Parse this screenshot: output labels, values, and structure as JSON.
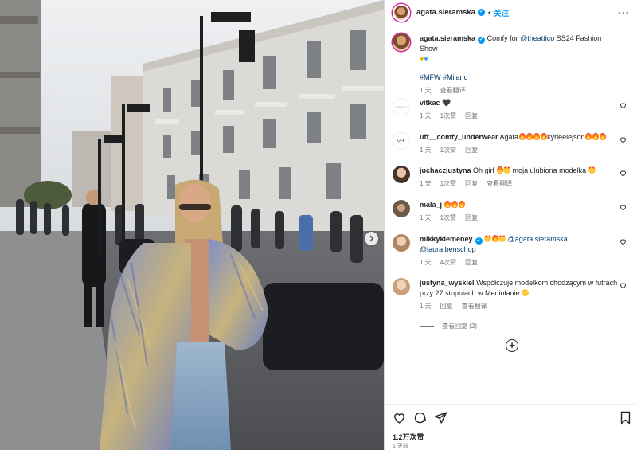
{
  "post": {
    "author": "agata.sieramska",
    "follow_label": "关注",
    "more_label": "···"
  },
  "caption": {
    "author": "agata.sieramska",
    "text_before": "Comfy for ",
    "mention": "@theattico",
    "text_after": " SS24 Fashion Show",
    "hashtags": "#MFW #Milano",
    "time": "1 天",
    "translate": "查看翻译"
  },
  "comments": [
    {
      "user": "vitkac",
      "text": "",
      "time": "1 天",
      "likes": "1次赞",
      "reply": "回复",
      "translate": ""
    },
    {
      "user": "uff__comfy_underwear",
      "text_before": "Agata",
      "text_after": "kyrieelejson",
      "time": "1 天",
      "likes": "1次赞",
      "reply": "回复",
      "translate": ""
    },
    {
      "user": "juchaczjustyna",
      "text_before": "Oh girl ",
      "text_after": " moja ulubiona modelka ",
      "time": "1 天",
      "likes": "1次赞",
      "reply": "回复",
      "translate": "查看翻译"
    },
    {
      "user": "mala_j",
      "text": "",
      "time": "1 天",
      "likes": "1次赞",
      "reply": "回复",
      "translate": ""
    },
    {
      "user": "mikkykiemeney",
      "mention1": "@agata.sieramska",
      "mention2": "@laura.benschop",
      "time": "1 天",
      "likes": "4次赞",
      "reply": "回复",
      "translate": ""
    },
    {
      "user": "justyna_wyskiel",
      "text": "Współczuje modelkom chodzącym w futrach przy 27 stopniach w Mediolanie ",
      "time": "1 天",
      "likes": "",
      "reply": "回复",
      "translate": "查看翻译",
      "view_replies": "查看回复 (2)"
    }
  ],
  "footer": {
    "likes": "1.2万次赞",
    "ago": "1 天前"
  },
  "icons": {
    "like": "heart-icon",
    "comment": "comment-icon",
    "share": "send-icon",
    "save": "bookmark-icon",
    "add": "add-circle-icon",
    "next": "chevron-right-icon"
  },
  "colors": {
    "link": "#00376b",
    "follow": "#0095f6",
    "verified": "#0095f6",
    "muted": "#737373"
  }
}
